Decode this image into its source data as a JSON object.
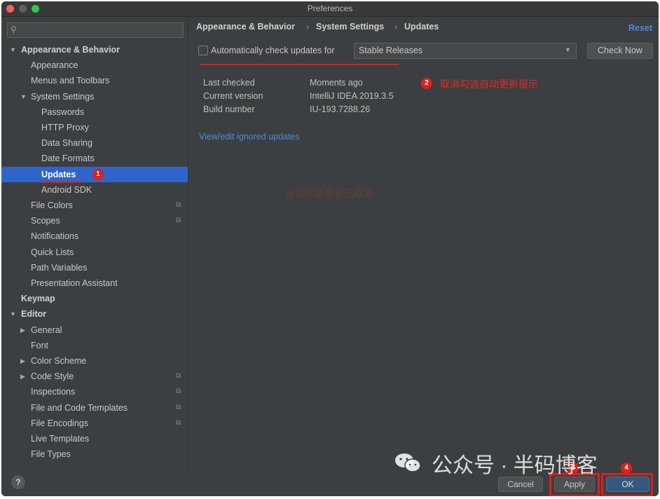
{
  "window": {
    "title": "Preferences"
  },
  "sidebar": {
    "search_placeholder": "",
    "items": [
      {
        "label": "Appearance & Behavior",
        "level": 0,
        "expanded": true,
        "bold": true
      },
      {
        "label": "Appearance",
        "level": 1
      },
      {
        "label": "Menus and Toolbars",
        "level": 1
      },
      {
        "label": "System Settings",
        "level": 1,
        "expanded": true
      },
      {
        "label": "Passwords",
        "level": 2
      },
      {
        "label": "HTTP Proxy",
        "level": 2
      },
      {
        "label": "Data Sharing",
        "level": 2
      },
      {
        "label": "Date Formats",
        "level": 2
      },
      {
        "label": "Updates",
        "level": 2,
        "selected": true
      },
      {
        "label": "Android SDK",
        "level": 2
      },
      {
        "label": "File Colors",
        "level": 1,
        "config": true
      },
      {
        "label": "Scopes",
        "level": 1,
        "config": true
      },
      {
        "label": "Notifications",
        "level": 1
      },
      {
        "label": "Quick Lists",
        "level": 1
      },
      {
        "label": "Path Variables",
        "level": 1
      },
      {
        "label": "Presentation Assistant",
        "level": 1
      },
      {
        "label": "Keymap",
        "level": 0,
        "bold": true
      },
      {
        "label": "Editor",
        "level": 0,
        "expanded": true,
        "bold": true
      },
      {
        "label": "General",
        "level": 1,
        "collapsed": true
      },
      {
        "label": "Font",
        "level": 1
      },
      {
        "label": "Color Scheme",
        "level": 1,
        "collapsed": true
      },
      {
        "label": "Code Style",
        "level": 1,
        "collapsed": true,
        "config": true
      },
      {
        "label": "Inspections",
        "level": 1,
        "config": true
      },
      {
        "label": "File and Code Templates",
        "level": 1,
        "config": true
      },
      {
        "label": "File Encodings",
        "level": 1,
        "config": true
      },
      {
        "label": "Live Templates",
        "level": 1
      },
      {
        "label": "File Types",
        "level": 1
      }
    ],
    "help_label": "?"
  },
  "breadcrumb": [
    "Appearance & Behavior",
    "System Settings",
    "Updates"
  ],
  "reset_label": "Reset",
  "auto_check": {
    "label": "Automatically check updates for",
    "checked": false
  },
  "channel": {
    "selected": "Stable Releases"
  },
  "check_now_label": "Check Now",
  "info": [
    {
      "key": "Last checked",
      "value": "Moments ago"
    },
    {
      "key": "Current version",
      "value": "IntelliJ IDEA 2019.3.5"
    },
    {
      "key": "Build number",
      "value": "IU-193.7288.26"
    }
  ],
  "ignored_link": "View/edit ignored updates",
  "annotations": {
    "badge1": "1",
    "badge2": "2",
    "badge3": "3",
    "badge4": "4",
    "note2": "取消勾选自动更新提示",
    "note_faint": "自动检查更新已取消"
  },
  "footer": {
    "cancel": "Cancel",
    "apply": "Apply",
    "ok": "OK"
  },
  "watermark": "公众号 · 半码博客",
  "colors": {
    "accent": "#2f65ca",
    "annotation_red": "#d9211d",
    "link": "#4b8bd8",
    "background": "#3c3f41"
  }
}
